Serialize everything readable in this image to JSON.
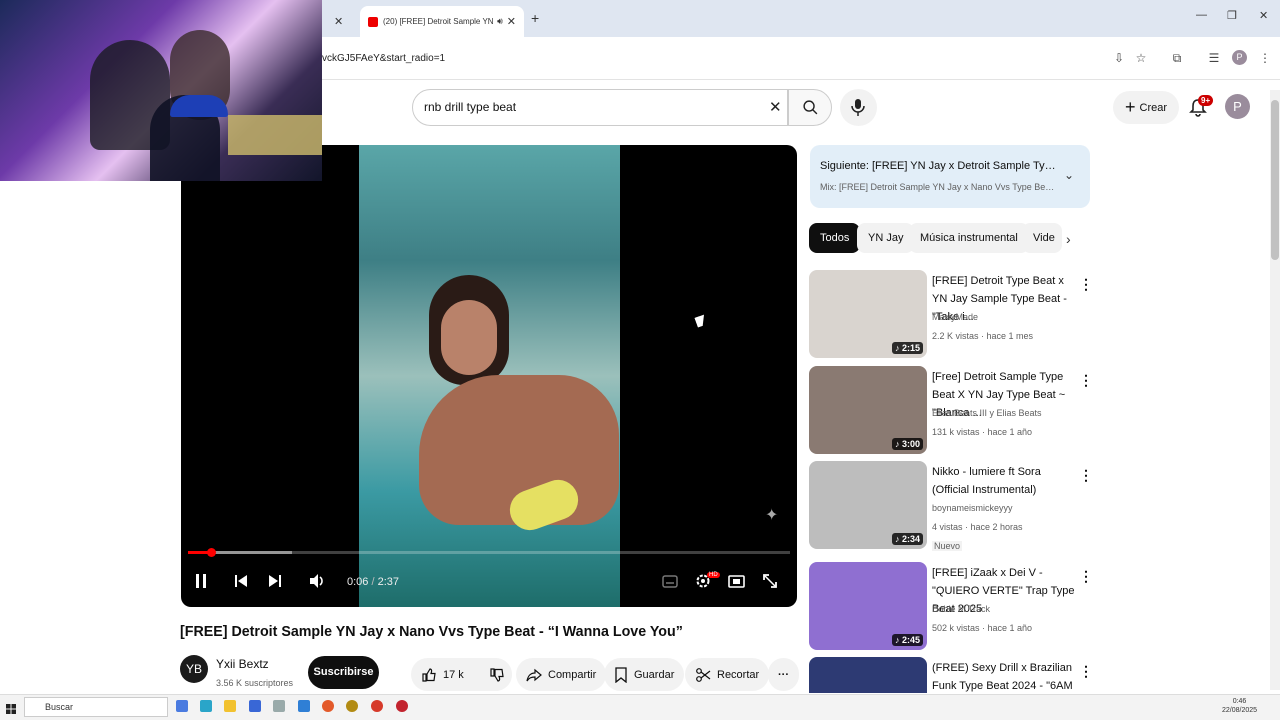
{
  "browser": {
    "inactive_tab_close": "✕",
    "active_tab_title": "(20) [FREE] Detroit Sample YN Jay x Na",
    "url": "vckGJ5FAeY&start_radio=1",
    "profile_initial": "P"
  },
  "header": {
    "search_value": "rnb drill type beat",
    "create_label": "Crear",
    "notifications_badge": "9+",
    "avatar_initial": "P"
  },
  "player": {
    "time_current": "0:06",
    "time_total": "2:37",
    "time_separator": " / ",
    "progress_fraction": 0.038,
    "buffered_fraction": 0.172,
    "hd_badge": "HD",
    "watermark": "YB"
  },
  "video": {
    "title": "[FREE] Detroit Sample YN Jay x Nano Vvs Type Beat - “I Wanna Love You”",
    "channel_name": "Yxii Bextz",
    "channel_avatar": "YB",
    "subscribers": "3.56 K suscriptores",
    "subscribe_label": "Suscribirse",
    "likes": "17 k",
    "share_label": "Compartir",
    "save_label": "Guardar",
    "clip_label": "Recortar"
  },
  "up_next": {
    "title": "Siguiente: [FREE] YN Jay x Detroit Sample Type Beat ...",
    "subtitle": "Mix: [FREE] Detroit Sample YN Jay x Nano Vvs Type Beat - \"I ..."
  },
  "chips": [
    "Todos",
    "YN Jay",
    "Música instrumental",
    "Vide"
  ],
  "recommendations": [
    {
      "title": "[FREE] Detroit Type Beat x YN Jay Sample Type Beat - \"Take i...",
      "channel": "MaxiyMade",
      "meta": "2.2 K vistas · hace 1 mes",
      "duration": "2:15",
      "badge": "",
      "color": "#d9d4cf"
    },
    {
      "title": "[Free] Detroit Sample Type Beat X YN Jay Type Beat ~ \"Blanca ...",
      "channel": "Elias Beats III y Elias Beats",
      "meta": "131 k vistas · hace 1 año",
      "duration": "3:00",
      "badge": "",
      "color": "#8a7a72"
    },
    {
      "title": "Nikko - lumiere ft Sora (Official Instrumental)",
      "channel": "boynameismickeyyy",
      "meta": "4 vistas · hace 2 horas",
      "duration": "2:34",
      "badge": "Nuevo",
      "color": "#bdbdbd"
    },
    {
      "title": "[FREE] iZaak x Dei V - \"QUIERO VERTE\" Trap Type Beat 2025",
      "channel": "Doble M Track",
      "meta": "502 k vistas · hace 1 año",
      "duration": "2:45",
      "badge": "",
      "color": "#8f6fd1"
    },
    {
      "title": "(FREE) Sexy Drill x Brazilian Funk Type Beat 2024 - \"6AM I...",
      "channel": "",
      "meta": "",
      "duration": "",
      "badge": "",
      "color": "#2d3a73"
    }
  ],
  "taskbar": {
    "search_placeholder": "Buscar",
    "time": "0:46",
    "date": "22/08/2025"
  }
}
